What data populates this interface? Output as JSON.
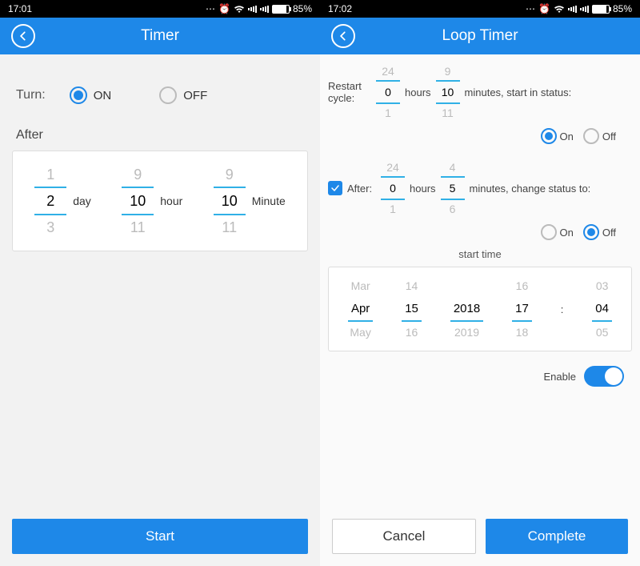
{
  "statusbar": {
    "battery_pct": "85%"
  },
  "left": {
    "time": "17:01",
    "title": "Timer",
    "turn_label": "Turn:",
    "on_label": "ON",
    "off_label": "OFF",
    "after_label": "After",
    "picker": {
      "day": {
        "prev": "1",
        "sel": "2",
        "next": "3",
        "unit": "day"
      },
      "hour": {
        "prev": "9",
        "sel": "10",
        "next": "11",
        "unit": "hour"
      },
      "minute": {
        "prev": "9",
        "sel": "10",
        "next": "11",
        "unit": "Minute"
      }
    },
    "start_btn": "Start"
  },
  "right": {
    "time": "17:02",
    "title": "Loop Timer",
    "restart_cycle_label": "Restart cycle:",
    "hours_unit": "hours",
    "minutes_status_label": "minutes, start in status:",
    "cycle": {
      "hours": {
        "prev": "24",
        "sel": "0",
        "next": "1"
      },
      "minutes": {
        "prev": "9",
        "sel": "10",
        "next": "11"
      }
    },
    "status1": {
      "on": "On",
      "off": "Off"
    },
    "after_label": "After:",
    "after": {
      "hours": {
        "prev": "24",
        "sel": "0",
        "next": "1"
      },
      "minutes": {
        "prev": "4",
        "sel": "5",
        "next": "6"
      }
    },
    "minutes_change_label": "minutes, change status to:",
    "status2": {
      "on": "On",
      "off": "Off"
    },
    "start_time_label": "start time",
    "datetime": {
      "month": {
        "prev": "Mar",
        "sel": "Apr",
        "next": "May"
      },
      "day": {
        "prev": "14",
        "sel": "15",
        "next": "16"
      },
      "year": {
        "prev": "",
        "sel": "2018",
        "next": "2019"
      },
      "hour": {
        "prev": "16",
        "sel": "17",
        "next": "18"
      },
      "minute": {
        "prev": "03",
        "sel": "04",
        "next": "05"
      }
    },
    "enable_label": "Enable",
    "cancel_btn": "Cancel",
    "complete_btn": "Complete"
  }
}
